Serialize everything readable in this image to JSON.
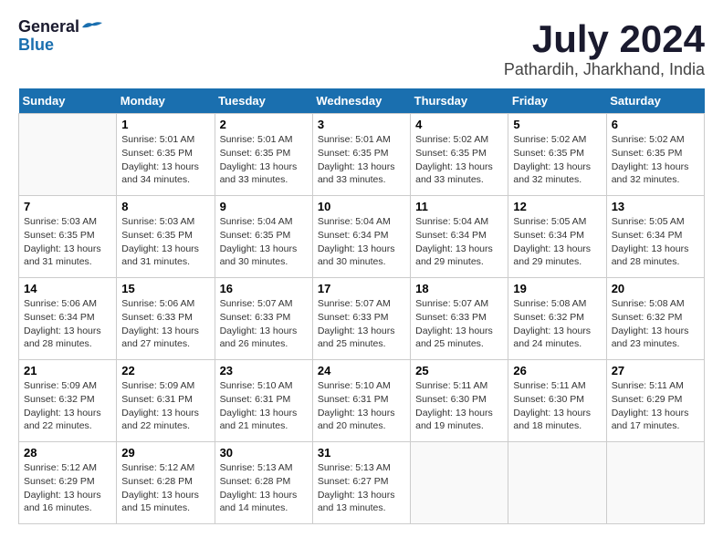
{
  "header": {
    "logo_general": "General",
    "logo_blue": "Blue",
    "month": "July 2024",
    "location": "Pathardih, Jharkhand, India"
  },
  "days_of_week": [
    "Sunday",
    "Monday",
    "Tuesday",
    "Wednesday",
    "Thursday",
    "Friday",
    "Saturday"
  ],
  "weeks": [
    [
      {
        "day": "",
        "info": ""
      },
      {
        "day": "1",
        "info": "Sunrise: 5:01 AM\nSunset: 6:35 PM\nDaylight: 13 hours\nand 34 minutes."
      },
      {
        "day": "2",
        "info": "Sunrise: 5:01 AM\nSunset: 6:35 PM\nDaylight: 13 hours\nand 33 minutes."
      },
      {
        "day": "3",
        "info": "Sunrise: 5:01 AM\nSunset: 6:35 PM\nDaylight: 13 hours\nand 33 minutes."
      },
      {
        "day": "4",
        "info": "Sunrise: 5:02 AM\nSunset: 6:35 PM\nDaylight: 13 hours\nand 33 minutes."
      },
      {
        "day": "5",
        "info": "Sunrise: 5:02 AM\nSunset: 6:35 PM\nDaylight: 13 hours\nand 32 minutes."
      },
      {
        "day": "6",
        "info": "Sunrise: 5:02 AM\nSunset: 6:35 PM\nDaylight: 13 hours\nand 32 minutes."
      }
    ],
    [
      {
        "day": "7",
        "info": "Sunrise: 5:03 AM\nSunset: 6:35 PM\nDaylight: 13 hours\nand 31 minutes."
      },
      {
        "day": "8",
        "info": "Sunrise: 5:03 AM\nSunset: 6:35 PM\nDaylight: 13 hours\nand 31 minutes."
      },
      {
        "day": "9",
        "info": "Sunrise: 5:04 AM\nSunset: 6:35 PM\nDaylight: 13 hours\nand 30 minutes."
      },
      {
        "day": "10",
        "info": "Sunrise: 5:04 AM\nSunset: 6:34 PM\nDaylight: 13 hours\nand 30 minutes."
      },
      {
        "day": "11",
        "info": "Sunrise: 5:04 AM\nSunset: 6:34 PM\nDaylight: 13 hours\nand 29 minutes."
      },
      {
        "day": "12",
        "info": "Sunrise: 5:05 AM\nSunset: 6:34 PM\nDaylight: 13 hours\nand 29 minutes."
      },
      {
        "day": "13",
        "info": "Sunrise: 5:05 AM\nSunset: 6:34 PM\nDaylight: 13 hours\nand 28 minutes."
      }
    ],
    [
      {
        "day": "14",
        "info": "Sunrise: 5:06 AM\nSunset: 6:34 PM\nDaylight: 13 hours\nand 28 minutes."
      },
      {
        "day": "15",
        "info": "Sunrise: 5:06 AM\nSunset: 6:33 PM\nDaylight: 13 hours\nand 27 minutes."
      },
      {
        "day": "16",
        "info": "Sunrise: 5:07 AM\nSunset: 6:33 PM\nDaylight: 13 hours\nand 26 minutes."
      },
      {
        "day": "17",
        "info": "Sunrise: 5:07 AM\nSunset: 6:33 PM\nDaylight: 13 hours\nand 25 minutes."
      },
      {
        "day": "18",
        "info": "Sunrise: 5:07 AM\nSunset: 6:33 PM\nDaylight: 13 hours\nand 25 minutes."
      },
      {
        "day": "19",
        "info": "Sunrise: 5:08 AM\nSunset: 6:32 PM\nDaylight: 13 hours\nand 24 minutes."
      },
      {
        "day": "20",
        "info": "Sunrise: 5:08 AM\nSunset: 6:32 PM\nDaylight: 13 hours\nand 23 minutes."
      }
    ],
    [
      {
        "day": "21",
        "info": "Sunrise: 5:09 AM\nSunset: 6:32 PM\nDaylight: 13 hours\nand 22 minutes."
      },
      {
        "day": "22",
        "info": "Sunrise: 5:09 AM\nSunset: 6:31 PM\nDaylight: 13 hours\nand 22 minutes."
      },
      {
        "day": "23",
        "info": "Sunrise: 5:10 AM\nSunset: 6:31 PM\nDaylight: 13 hours\nand 21 minutes."
      },
      {
        "day": "24",
        "info": "Sunrise: 5:10 AM\nSunset: 6:31 PM\nDaylight: 13 hours\nand 20 minutes."
      },
      {
        "day": "25",
        "info": "Sunrise: 5:11 AM\nSunset: 6:30 PM\nDaylight: 13 hours\nand 19 minutes."
      },
      {
        "day": "26",
        "info": "Sunrise: 5:11 AM\nSunset: 6:30 PM\nDaylight: 13 hours\nand 18 minutes."
      },
      {
        "day": "27",
        "info": "Sunrise: 5:11 AM\nSunset: 6:29 PM\nDaylight: 13 hours\nand 17 minutes."
      }
    ],
    [
      {
        "day": "28",
        "info": "Sunrise: 5:12 AM\nSunset: 6:29 PM\nDaylight: 13 hours\nand 16 minutes."
      },
      {
        "day": "29",
        "info": "Sunrise: 5:12 AM\nSunset: 6:28 PM\nDaylight: 13 hours\nand 15 minutes."
      },
      {
        "day": "30",
        "info": "Sunrise: 5:13 AM\nSunset: 6:28 PM\nDaylight: 13 hours\nand 14 minutes."
      },
      {
        "day": "31",
        "info": "Sunrise: 5:13 AM\nSunset: 6:27 PM\nDaylight: 13 hours\nand 13 minutes."
      },
      {
        "day": "",
        "info": ""
      },
      {
        "day": "",
        "info": ""
      },
      {
        "day": "",
        "info": ""
      }
    ]
  ]
}
